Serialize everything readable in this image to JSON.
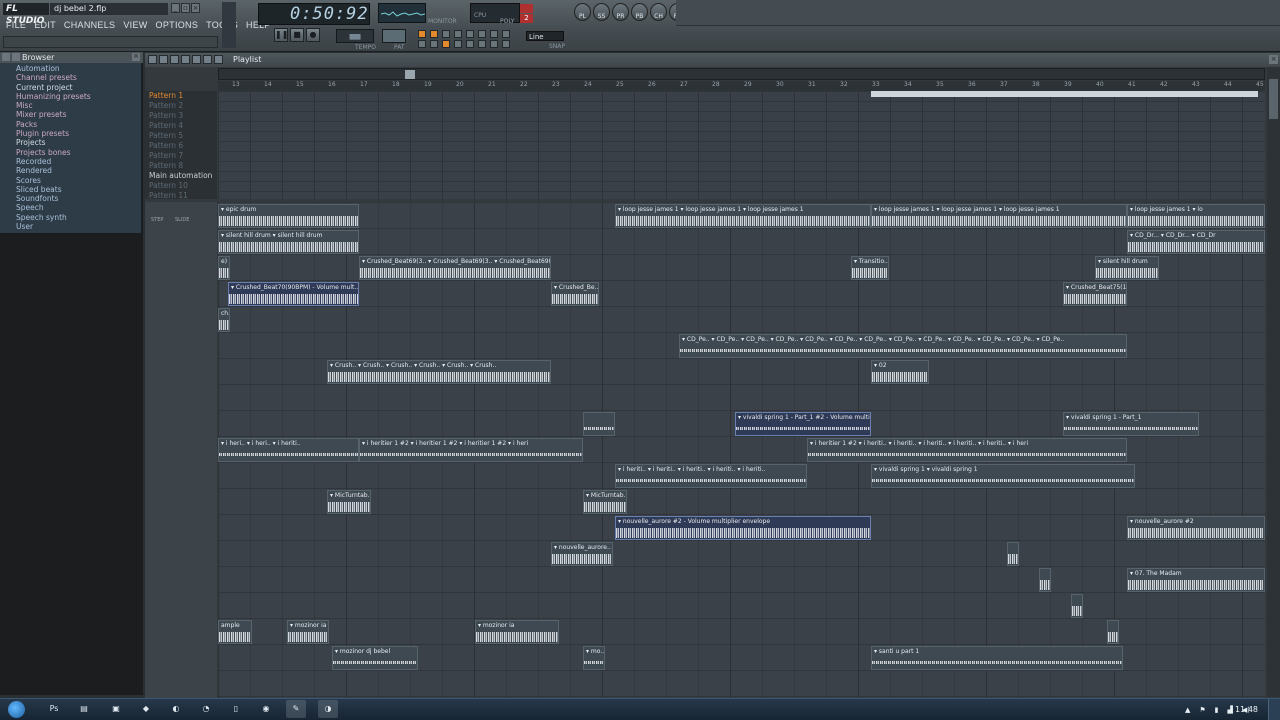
{
  "app": {
    "logo": "FL STUDIO",
    "filename": "dj bebel 2.flp"
  },
  "menu": [
    "FILE",
    "EDIT",
    "CHANNELS",
    "VIEW",
    "OPTIONS",
    "TOOLS",
    "HELP"
  ],
  "transport": {
    "time": "0:50:92",
    "tempo_label": "TEMPO",
    "pat_label": "PAT",
    "monitor_label": "MONITOR",
    "cpu_label": "CPU",
    "poly_label": "POLY",
    "snap_label": "SNAP",
    "snap_value": "Line",
    "counter_top": "",
    "counter_bottom": "2"
  },
  "browser": {
    "title": "Browser",
    "items": [
      {
        "label": "Automation",
        "style": "blue"
      },
      {
        "label": "Channel presets",
        "style": "pink"
      },
      {
        "label": "Current project",
        "style": "white"
      },
      {
        "label": "Humanizing presets",
        "style": "pink"
      },
      {
        "label": "Misc",
        "style": "pink"
      },
      {
        "label": "Mixer presets",
        "style": "pink"
      },
      {
        "label": "Packs",
        "style": "pink"
      },
      {
        "label": "Plugin presets",
        "style": "pink"
      },
      {
        "label": "Projects",
        "style": "white"
      },
      {
        "label": "Projects bones",
        "style": "pink"
      },
      {
        "label": "Recorded",
        "style": "blue"
      },
      {
        "label": "Rendered",
        "style": "blue"
      },
      {
        "label": "Scores",
        "style": "blue"
      },
      {
        "label": "Sliced beats",
        "style": "blue"
      },
      {
        "label": "Soundfonts",
        "style": "blue"
      },
      {
        "label": "Speech",
        "style": "blue"
      },
      {
        "label": "Speech synth",
        "style": "blue"
      },
      {
        "label": "User",
        "style": "blue"
      }
    ]
  },
  "playlist": {
    "title": "Playlist",
    "step_label": "STEP",
    "slide_label": "SLIDE",
    "ruler": [
      "13",
      "14",
      "15",
      "16",
      "17",
      "18",
      "19",
      "20",
      "21",
      "22",
      "23",
      "24",
      "25",
      "26",
      "27",
      "28",
      "29",
      "30",
      "31",
      "32",
      "33",
      "34",
      "35",
      "36",
      "37",
      "38",
      "39",
      "40",
      "41",
      "42",
      "43",
      "44",
      "45"
    ],
    "patterns": [
      {
        "label": "Pattern 1",
        "style": "active"
      },
      {
        "label": "Pattern 2",
        "style": ""
      },
      {
        "label": "Pattern 3",
        "style": ""
      },
      {
        "label": "Pattern 4",
        "style": ""
      },
      {
        "label": "Pattern 5",
        "style": ""
      },
      {
        "label": "Pattern 6",
        "style": ""
      },
      {
        "label": "Pattern 7",
        "style": ""
      },
      {
        "label": "Pattern 8",
        "style": ""
      },
      {
        "label": "Main automation",
        "style": "main"
      },
      {
        "label": "Pattern 10",
        "style": ""
      },
      {
        "label": "Pattern 11",
        "style": ""
      }
    ],
    "clips": [
      {
        "row": 0,
        "start": 0,
        "len": 141,
        "label": "▾ epic drum"
      },
      {
        "row": 0,
        "start": 397,
        "len": 256,
        "label": "▾ loop jesse james 1 ▾ loop jesse james 1 ▾ loop jesse james 1"
      },
      {
        "row": 0,
        "start": 653,
        "len": 256,
        "label": "▾ loop jesse james 1 ▾ loop jesse james 1 ▾ loop jesse james 1"
      },
      {
        "row": 0,
        "start": 909,
        "len": 138,
        "label": "▾ loop jesse james 1 ▾ lo"
      },
      {
        "row": 1,
        "start": 0,
        "len": 141,
        "label": "▾ silent hill drum   ▾ silent hill drum"
      },
      {
        "row": 1,
        "start": 909,
        "len": 138,
        "label": "▾ CD_Dr... ▾ CD_Dr... ▾ CD_Dr"
      },
      {
        "row": 2,
        "start": 0,
        "len": 12,
        "label": "e)"
      },
      {
        "row": 2,
        "start": 141,
        "len": 192,
        "label": "▾ Crushed_Beat69(3.. ▾ Crushed_Beat69(3.. ▾ Crushed_Beat69(3"
      },
      {
        "row": 2,
        "start": 633,
        "len": 38,
        "label": "▾ Transitio.."
      },
      {
        "row": 2,
        "start": 877,
        "len": 64,
        "label": "▾ silent hill drum"
      },
      {
        "row": 3,
        "start": 10,
        "len": 131,
        "label": "▾ Crushed_Beat70(90BPM) - Volume mult.. 9",
        "sel": true
      },
      {
        "row": 3,
        "start": 333,
        "len": 48,
        "label": "▾ Crushed_Be.."
      },
      {
        "row": 3,
        "start": 845,
        "len": 64,
        "label": "▾ Crushed_Beat75(1.."
      },
      {
        "row": 4,
        "start": 0,
        "len": 12,
        "label": "ch.."
      },
      {
        "row": 5,
        "start": 461,
        "len": 448,
        "label": "▾ CD_Pe.. ▾ CD_Pe.. ▾ CD_Pe.. ▾ CD_Pe.. ▾ CD_Pe.. ▾ CD_Pe.. ▾ CD_Pe.. ▾ CD_Pe.. ▾ CD_Pe.. ▾ CD_Pe.. ▾ CD_Pe.. ▾ CD_Pe.. ▾ CD_Pe.."
      },
      {
        "row": 6,
        "start": 109,
        "len": 224,
        "label": "▾ Crush.. ▾ Crush.. ▾ Crush.. ▾ Crush.. ▾ Crush.. ▾ Crush.."
      },
      {
        "row": 6,
        "start": 653,
        "len": 58,
        "label": "▾ 02"
      },
      {
        "row": 8,
        "start": 365,
        "len": 32,
        "label": ""
      },
      {
        "row": 8,
        "start": 517,
        "len": 136,
        "label": "▾ vivaldi spring 1 - Part_1 #2 - Volume multiplie..",
        "sel": true
      },
      {
        "row": 8,
        "start": 845,
        "len": 136,
        "label": "▾ vivaldi spring 1 - Part_1"
      },
      {
        "row": 9,
        "start": 0,
        "len": 141,
        "label": "▾ i heri.. ▾ i heri.. ▾ i heriti.."
      },
      {
        "row": 9,
        "start": 141,
        "len": 224,
        "label": "▾ i heritier 1 #2  ▾ i heritier 1 #2  ▾ i heritier 1 #2 ▾ i heri"
      },
      {
        "row": 9,
        "start": 589,
        "len": 320,
        "label": "▾ i heritier 1 #2 ▾ i heriti.. ▾ i heriti.. ▾ i heriti.. ▾ i heriti.. ▾ i heriti.. ▾ i heri"
      },
      {
        "row": 10,
        "start": 397,
        "len": 192,
        "label": "▾ i heriti.. ▾ i heriti.. ▾ i heriti.. ▾ i heriti.. ▾ i heriti.."
      },
      {
        "row": 10,
        "start": 653,
        "len": 264,
        "label": "▾ vivaldi spring 1             ▾ vivaldi spring 1"
      },
      {
        "row": 11,
        "start": 109,
        "len": 44,
        "label": "▾ MicTurntab.."
      },
      {
        "row": 11,
        "start": 365,
        "len": 44,
        "label": "▾ MicTurntab.."
      },
      {
        "row": 12,
        "start": 397,
        "len": 256,
        "label": "▾ nouvelle_aurore #2 - Volume multiplier envelope",
        "sel": true
      },
      {
        "row": 12,
        "start": 909,
        "len": 138,
        "label": "▾ nouvelle_aurore #2"
      },
      {
        "row": 13,
        "start": 333,
        "len": 62,
        "label": "▾ nouvelle_aurore.."
      },
      {
        "row": 13,
        "start": 789,
        "len": 12,
        "label": ""
      },
      {
        "row": 14,
        "start": 821,
        "len": 12,
        "label": ""
      },
      {
        "row": 14,
        "start": 909,
        "len": 138,
        "label": "▾ 07. The Madam"
      },
      {
        "row": 15,
        "start": 853,
        "len": 12,
        "label": ""
      },
      {
        "row": 16,
        "start": 0,
        "len": 34,
        "label": "ample"
      },
      {
        "row": 16,
        "start": 69,
        "len": 42,
        "label": "▾ mozinor ia"
      },
      {
        "row": 16,
        "start": 257,
        "len": 84,
        "label": "▾ mozinor ia"
      },
      {
        "row": 16,
        "start": 889,
        "len": 12,
        "label": ""
      },
      {
        "row": 17,
        "start": 114,
        "len": 86,
        "label": "▾ mozinor dj bebel"
      },
      {
        "row": 17,
        "start": 365,
        "len": 22,
        "label": "▾ mo.."
      },
      {
        "row": 17,
        "start": 653,
        "len": 252,
        "label": "▾ santi u part 1"
      }
    ]
  },
  "taskbar": {
    "clock": "11:48",
    "apps": [
      "start",
      "ps",
      "explorer",
      "media",
      "3d",
      "steam",
      "clock",
      "files",
      "firefox",
      "fl-tools",
      "fl-studio"
    ]
  },
  "colors": {
    "accent": "#e48a2e",
    "browser_bg": "#2e3c47",
    "selected_clip": "#2f3a56"
  }
}
